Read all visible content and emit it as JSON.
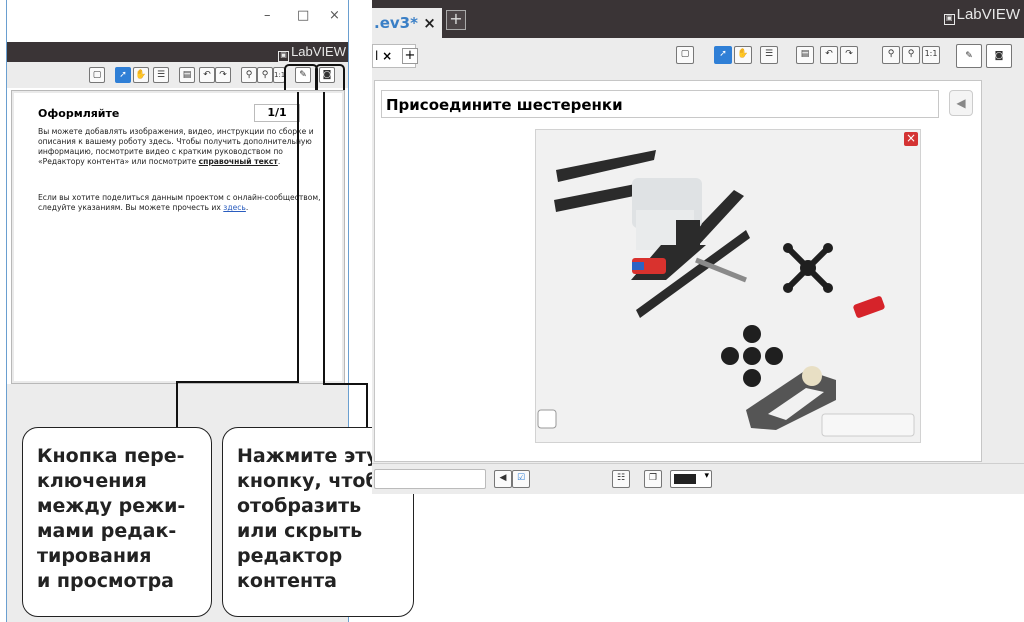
{
  "left_window": {
    "caption": {
      "minimize": "–",
      "maximize": "□",
      "close": "×"
    },
    "brand": "LabVIEW",
    "toolbar": {
      "icons": [
        "page-icon",
        "pointer-icon",
        "hand-icon",
        "list-icon",
        "save-icon",
        "undo-icon",
        "redo-icon",
        "zoom-out-icon",
        "zoom-in-icon",
        "zoom-reset-icon",
        "edit-mode-icon",
        "content-editor-icon"
      ],
      "zoom_reset_label": "1:1"
    },
    "panel": {
      "heading": "Оформляйте",
      "page_counter": "1/1",
      "paragraph1_a": "Вы можете добавлять изображения, видео, инструкции по сборке и описания к вашему роботу здесь. Чтобы получить дополнительную информацию, посмотрите видео с кратким руководством по «Редактору контента» или посмотрите ",
      "paragraph1_link": "справочный текст",
      "paragraph1_end": ".",
      "paragraph2_a": "Если вы хотите поделиться данным проектом с онлайн-сообществом, следуйте указаниям. Вы можете прочесть их ",
      "paragraph2_link": "здесь",
      "paragraph2_end": "."
    }
  },
  "callouts": {
    "mode_toggle": "Кнопка пере-\nключения\nмежду режи-\nмами редак-\nтирования\nи просмотра",
    "content_editor": "Нажмите эту\nкнопку, чтобы\nотобразить\nили скрыть\nредактор\nконтента"
  },
  "right_window": {
    "brand": "LabVIEW",
    "tab_label": ".ev3",
    "tab_modified_marker": "*",
    "tab_close": "×",
    "tab_add": "+",
    "doc_tab_label": "l",
    "doc_tab_close": "×",
    "doc_tab_add": "+",
    "toolbar": {
      "zoom_reset_label": "1:1"
    },
    "content_title": "Присоедините шестеренки",
    "photo_alt": "LEGO gears assembly photo",
    "photo_close": "×",
    "bottom_toolbar_icons": [
      "back-icon",
      "check-icon",
      "list-icon",
      "layers-icon",
      "color-picker-icon"
    ]
  },
  "colors": {
    "dark_bar": "#3a3436",
    "tab_accent": "#3a7fc6",
    "selected_tool": "#2f7fd6",
    "window_border": "#6a9fd0",
    "close_red": "#d43333"
  }
}
